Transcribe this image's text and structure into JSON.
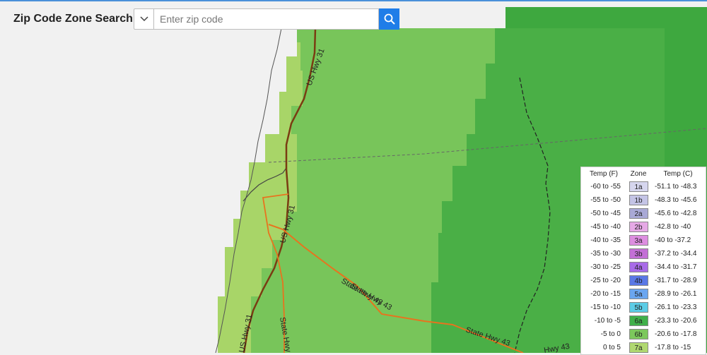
{
  "header": {
    "title": "Zip Code Zone Search",
    "search_placeholder": "Enter zip code",
    "search_value": ""
  },
  "map": {
    "road_labels": [
      "US Hwy 31",
      "US Hwy 31",
      "US Hwy 31",
      "State Hwy 43",
      "State Hwy 43",
      "State Hwy 43",
      "State Hwy",
      "Hwy 43"
    ],
    "zone_colors": {
      "lake": "#f1f1f1",
      "zone_light": "#a8d568",
      "zone_mid": "#78c55a",
      "zone_dark": "#4aaf46"
    }
  },
  "legend": {
    "headers": [
      "Temp (F)",
      "Zone",
      "Temp (C)"
    ],
    "rows": [
      {
        "f": "-60 to -55",
        "zone": "1a",
        "c": "-51.1 to -48.3",
        "color": "#d6d6ee"
      },
      {
        "f": "-55 to -50",
        "zone": "1b",
        "c": "-48.3 to -45.6",
        "color": "#c4c4e6"
      },
      {
        "f": "-50 to -45",
        "zone": "2a",
        "c": "-45.6 to -42.8",
        "color": "#a9a9d6"
      },
      {
        "f": "-45 to -40",
        "zone": "2b",
        "c": "-42.8 to -40",
        "color": "#e6a9e6"
      },
      {
        "f": "-40 to -35",
        "zone": "3a",
        "c": "-40 to -37.2",
        "color": "#dd8ee0"
      },
      {
        "f": "-35 to -30",
        "zone": "3b",
        "c": "-37.2 to -34.4",
        "color": "#c36fd6"
      },
      {
        "f": "-30 to -25",
        "zone": "4a",
        "c": "-34.4 to -31.7",
        "color": "#a86be8"
      },
      {
        "f": "-25 to -20",
        "zone": "4b",
        "c": "-31.7 to -28.9",
        "color": "#5a78e6"
      },
      {
        "f": "-20 to -15",
        "zone": "5a",
        "c": "-28.9 to -26.1",
        "color": "#6aa6f0"
      },
      {
        "f": "-15 to -10",
        "zone": "5b",
        "c": "-26.1 to -23.3",
        "color": "#5ccce6"
      },
      {
        "f": "-10 to -5",
        "zone": "6a",
        "c": "-23.3 to -20.6",
        "color": "#40b04a"
      },
      {
        "f": "-5 to 0",
        "zone": "6b",
        "c": "-20.6 to -17.8",
        "color": "#7cc85c"
      },
      {
        "f": "0 to 5",
        "zone": "7a",
        "c": "-17.8 to -15",
        "color": "#b0d870"
      }
    ]
  }
}
